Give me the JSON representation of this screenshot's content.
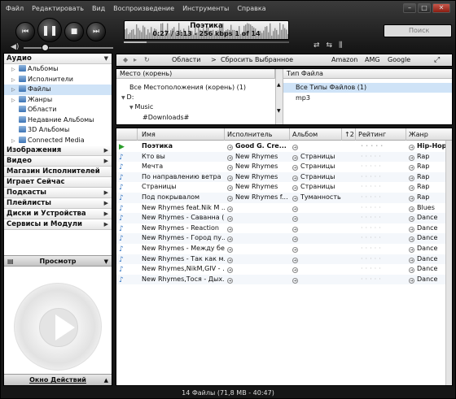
{
  "menu": [
    "Файл",
    "Редактировать",
    "Вид",
    "Воспроизведение",
    "Инструменты",
    "Справка"
  ],
  "window_buttons": {
    "minimize": "–",
    "maximize": "□",
    "close": "✕"
  },
  "now_playing": {
    "title": "Поэтика",
    "info": "0:27 / 3:13 - 256 kbps   1 of 14",
    "progress": 0.14
  },
  "search": {
    "placeholder": "Поиск"
  },
  "left_nav": {
    "audio_header": "Аудио",
    "audio_items": [
      {
        "label": "Альбомы"
      },
      {
        "label": "Исполнители"
      },
      {
        "label": "Файлы"
      },
      {
        "label": "Жанры"
      },
      {
        "label": "Области"
      },
      {
        "label": "Недавние Альбомы"
      },
      {
        "label": "3D Альбомы"
      },
      {
        "label": "Connected Media"
      }
    ],
    "sections": [
      "Изображения",
      "Видео",
      "Магазин Исполнителей",
      "Играет Сейчас",
      "Подкасты",
      "Плейлисты",
      "Диски и Устройства",
      "Сервисы и Модули"
    ],
    "view_label": "Просмотр",
    "action_label": "Окно Действий"
  },
  "breadcrumb": {
    "areas": "Области",
    "sep": ">",
    "reset": "Сбросить Выбранное",
    "links": [
      "Amazon",
      "AMG",
      "Google"
    ]
  },
  "filters": {
    "location_header": "Место (корень)",
    "location_items": [
      "Все Местоположения (корень) (1)",
      "D:",
      "Music",
      "#Downloads#"
    ],
    "type_header": "Тип Файла",
    "type_items": [
      "Все Типы Файлов (1)",
      "mp3"
    ]
  },
  "table": {
    "columns": [
      "Имя",
      "Исполнитель",
      "Альбом",
      "↑2",
      "Рейтинг",
      "Жанр"
    ],
    "rows": [
      {
        "name": "Поэтика",
        "artist": "Good G. Cre...",
        "album": "",
        "genre": "Hip-Hop",
        "playing": true
      },
      {
        "name": "Кто вы",
        "artist": "New Rhymes",
        "album": "Страницы",
        "genre": "Rap"
      },
      {
        "name": "Мечта",
        "artist": "New Rhymes",
        "album": "Страницы",
        "genre": "Rap"
      },
      {
        "name": "По направлению ветра",
        "artist": "New Rhymes",
        "album": "Страницы",
        "genre": "Rap"
      },
      {
        "name": "Страницы",
        "artist": "New Rhymes",
        "album": "Страницы",
        "genre": "Rap"
      },
      {
        "name": "Под покрывалом",
        "artist": "New Rhymes f...",
        "album": "Туманность",
        "genre": "Rap"
      },
      {
        "name": "New Rhymes feat.Nik M ...",
        "artist": "",
        "album": "",
        "genre": "Blues"
      },
      {
        "name": "New Rhymes - Саванна (Dance ...",
        "artist": "",
        "album": "",
        "genre": "Dance"
      },
      {
        "name": "New Rhymes - Reaction",
        "artist": "",
        "album": "",
        "genre": "Dance"
      },
      {
        "name": "New Rhymes - Город пу...",
        "artist": "",
        "album": "",
        "genre": "Dance"
      },
      {
        "name": "New Rhymes - Между бе...",
        "artist": "",
        "album": "",
        "genre": "Dance"
      },
      {
        "name": "New Rhymes - Так как м...",
        "artist": "",
        "album": "",
        "genre": "Dance"
      },
      {
        "name": "New Rhymes,NikM,GIV - ...",
        "artist": "",
        "album": "",
        "genre": "Dance"
      },
      {
        "name": "New Rhymes,Тося - Дых...",
        "artist": "",
        "album": "",
        "genre": "Dance"
      }
    ]
  },
  "status": "14 Файлы (71,8 MB - 40:47)"
}
